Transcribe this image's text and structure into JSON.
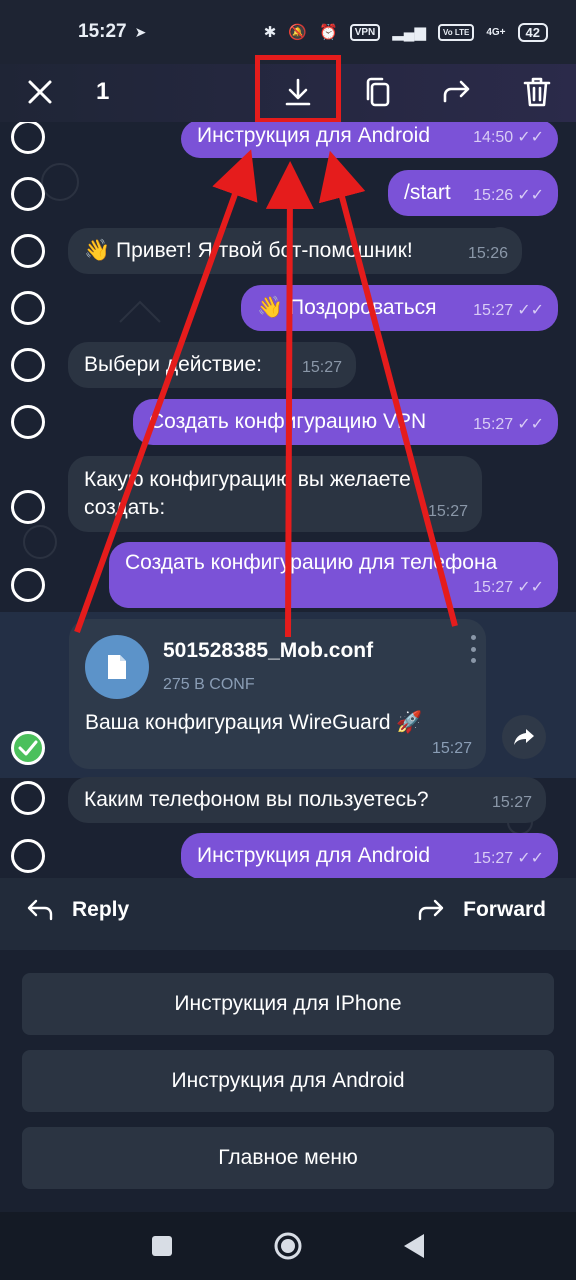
{
  "status": {
    "time": "15:27",
    "battery": "42",
    "vpn_label": "VPN",
    "network_label": "4G+",
    "volte_label": "Vo LTE"
  },
  "action_bar": {
    "selected_count": "1",
    "icons": [
      "close-icon",
      "download-icon",
      "copy-icon",
      "forward-icon",
      "trash-icon"
    ]
  },
  "messages": [
    {
      "text": "Инструкция для Android",
      "time": "14:50",
      "dir": "out"
    },
    {
      "text": "/start",
      "time": "15:26",
      "dir": "out"
    },
    {
      "text": "👋 Привет! Я твой бот-помошник!",
      "time": "15:26",
      "dir": "in"
    },
    {
      "text": "👋 Поздороваться",
      "time": "15:27",
      "dir": "out"
    },
    {
      "text": "Выбери действие:",
      "time": "15:27",
      "dir": "in"
    },
    {
      "text": "Создать конфигурацию VPN",
      "time": "15:27",
      "dir": "out"
    },
    {
      "text": "Какую конфигурацию вы желаете создать:",
      "time": "15:27",
      "dir": "in"
    },
    {
      "text": "Создать конфигурацию для телефона",
      "time": "15:27",
      "dir": "out"
    },
    {
      "text": "Каким телефоном вы пользуетесь?",
      "time": "15:27",
      "dir": "in"
    },
    {
      "text": "Инструкция для Android",
      "time": "15:27",
      "dir": "out"
    }
  ],
  "file_message": {
    "file_name": "501528385_Mob.conf",
    "file_meta": "275 B CONF",
    "caption": "Ваша конфигурация WireGuard 🚀",
    "time": "15:27"
  },
  "reply_bar": {
    "reply_label": "Reply",
    "forward_label": "Forward"
  },
  "keyboard": {
    "buttons": [
      "Инструкция для IPhone",
      "Инструкция для Android",
      "Главное меню"
    ]
  },
  "colors": {
    "outgoing_bubble": "#7b52d7",
    "incoming_bubble": "#2b3442",
    "selection_check": "#4bc05c",
    "annotation_red": "#e51c1c"
  }
}
